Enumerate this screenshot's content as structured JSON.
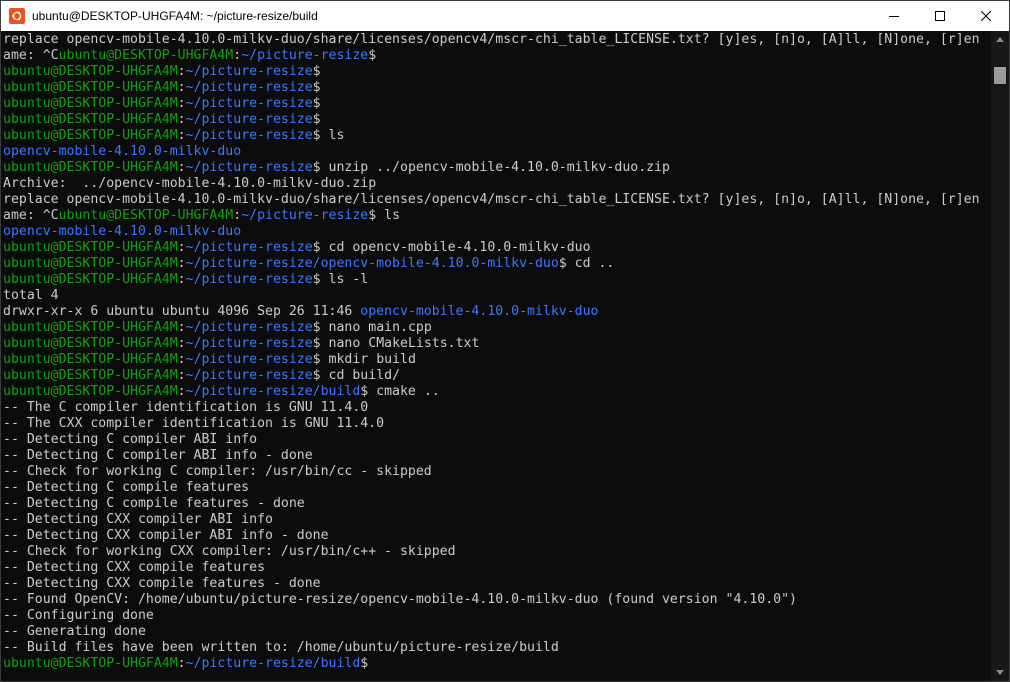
{
  "window": {
    "title": "ubuntu@DESKTOP-UHGFA4M: ~/picture-resize/build",
    "icon": "ubuntu-terminal-icon",
    "controls": [
      "minimize-icon",
      "maximize-icon",
      "close-icon"
    ]
  },
  "colors": {
    "background": "#0c0c0c",
    "text": "#cccccc",
    "prompt_user": "#13a10e",
    "prompt_path": "#3b78ff"
  },
  "terminal": {
    "lines": [
      [
        {
          "t": "replace opencv-mobile-4.10.0-milkv-duo/share/licenses/opencv4/mscr-chi_table_LICENSE.txt? [y]es, [n]o, [A]ll, [N]one, [r]en",
          "c": "white"
        }
      ],
      [
        {
          "t": "ame: ^C",
          "c": "white"
        },
        {
          "t": "ubuntu@DESKTOP-UHGFA4M",
          "c": "green"
        },
        {
          "t": ":",
          "c": "white"
        },
        {
          "t": "~/picture-resize",
          "c": "blue"
        },
        {
          "t": "$",
          "c": "white"
        }
      ],
      [
        {
          "t": "ubuntu@DESKTOP-UHGFA4M",
          "c": "green"
        },
        {
          "t": ":",
          "c": "white"
        },
        {
          "t": "~/picture-resize",
          "c": "blue"
        },
        {
          "t": "$",
          "c": "white"
        }
      ],
      [
        {
          "t": "ubuntu@DESKTOP-UHGFA4M",
          "c": "green"
        },
        {
          "t": ":",
          "c": "white"
        },
        {
          "t": "~/picture-resize",
          "c": "blue"
        },
        {
          "t": "$",
          "c": "white"
        }
      ],
      [
        {
          "t": "ubuntu@DESKTOP-UHGFA4M",
          "c": "green"
        },
        {
          "t": ":",
          "c": "white"
        },
        {
          "t": "~/picture-resize",
          "c": "blue"
        },
        {
          "t": "$",
          "c": "white"
        }
      ],
      [
        {
          "t": "ubuntu@DESKTOP-UHGFA4M",
          "c": "green"
        },
        {
          "t": ":",
          "c": "white"
        },
        {
          "t": "~/picture-resize",
          "c": "blue"
        },
        {
          "t": "$",
          "c": "white"
        }
      ],
      [
        {
          "t": "ubuntu@DESKTOP-UHGFA4M",
          "c": "green"
        },
        {
          "t": ":",
          "c": "white"
        },
        {
          "t": "~/picture-resize",
          "c": "blue"
        },
        {
          "t": "$ ls",
          "c": "white"
        }
      ],
      [
        {
          "t": "opencv-mobile-4.10.0-milkv-duo",
          "c": "blue"
        }
      ],
      [
        {
          "t": "ubuntu@DESKTOP-UHGFA4M",
          "c": "green"
        },
        {
          "t": ":",
          "c": "white"
        },
        {
          "t": "~/picture-resize",
          "c": "blue"
        },
        {
          "t": "$ unzip ../opencv-mobile-4.10.0-milkv-duo.zip",
          "c": "white"
        }
      ],
      [
        {
          "t": "Archive:  ../opencv-mobile-4.10.0-milkv-duo.zip",
          "c": "white"
        }
      ],
      [
        {
          "t": "replace opencv-mobile-4.10.0-milkv-duo/share/licenses/opencv4/mscr-chi_table_LICENSE.txt? [y]es, [n]o, [A]ll, [N]one, [r]en",
          "c": "white"
        }
      ],
      [
        {
          "t": "ame: ^C",
          "c": "white"
        },
        {
          "t": "ubuntu@DESKTOP-UHGFA4M",
          "c": "green"
        },
        {
          "t": ":",
          "c": "white"
        },
        {
          "t": "~/picture-resize",
          "c": "blue"
        },
        {
          "t": "$ ls",
          "c": "white"
        }
      ],
      [
        {
          "t": "opencv-mobile-4.10.0-milkv-duo",
          "c": "blue"
        }
      ],
      [
        {
          "t": "ubuntu@DESKTOP-UHGFA4M",
          "c": "green"
        },
        {
          "t": ":",
          "c": "white"
        },
        {
          "t": "~/picture-resize",
          "c": "blue"
        },
        {
          "t": "$ cd opencv-mobile-4.10.0-milkv-duo",
          "c": "white"
        }
      ],
      [
        {
          "t": "ubuntu@DESKTOP-UHGFA4M",
          "c": "green"
        },
        {
          "t": ":",
          "c": "white"
        },
        {
          "t": "~/picture-resize/opencv-mobile-4.10.0-milkv-duo",
          "c": "blue"
        },
        {
          "t": "$ cd ..",
          "c": "white"
        }
      ],
      [
        {
          "t": "ubuntu@DESKTOP-UHGFA4M",
          "c": "green"
        },
        {
          "t": ":",
          "c": "white"
        },
        {
          "t": "~/picture-resize",
          "c": "blue"
        },
        {
          "t": "$ ls -l",
          "c": "white"
        }
      ],
      [
        {
          "t": "total 4",
          "c": "white"
        }
      ],
      [
        {
          "t": "drwxr-xr-x 6 ubuntu ubuntu 4096 Sep 26 11:46 ",
          "c": "white"
        },
        {
          "t": "opencv-mobile-4.10.0-milkv-duo",
          "c": "blue"
        }
      ],
      [
        {
          "t": "ubuntu@DESKTOP-UHGFA4M",
          "c": "green"
        },
        {
          "t": ":",
          "c": "white"
        },
        {
          "t": "~/picture-resize",
          "c": "blue"
        },
        {
          "t": "$ nano main.cpp",
          "c": "white"
        }
      ],
      [
        {
          "t": "ubuntu@DESKTOP-UHGFA4M",
          "c": "green"
        },
        {
          "t": ":",
          "c": "white"
        },
        {
          "t": "~/picture-resize",
          "c": "blue"
        },
        {
          "t": "$ nano CMakeLists.txt",
          "c": "white"
        }
      ],
      [
        {
          "t": "ubuntu@DESKTOP-UHGFA4M",
          "c": "green"
        },
        {
          "t": ":",
          "c": "white"
        },
        {
          "t": "~/picture-resize",
          "c": "blue"
        },
        {
          "t": "$ mkdir build",
          "c": "white"
        }
      ],
      [
        {
          "t": "ubuntu@DESKTOP-UHGFA4M",
          "c": "green"
        },
        {
          "t": ":",
          "c": "white"
        },
        {
          "t": "~/picture-resize",
          "c": "blue"
        },
        {
          "t": "$ cd build/",
          "c": "white"
        }
      ],
      [
        {
          "t": "ubuntu@DESKTOP-UHGFA4M",
          "c": "green"
        },
        {
          "t": ":",
          "c": "white"
        },
        {
          "t": "~/picture-resize/build",
          "c": "blue"
        },
        {
          "t": "$ cmake ..",
          "c": "white"
        }
      ],
      [
        {
          "t": "-- The C compiler identification is GNU 11.4.0",
          "c": "white"
        }
      ],
      [
        {
          "t": "-- The CXX compiler identification is GNU 11.4.0",
          "c": "white"
        }
      ],
      [
        {
          "t": "-- Detecting C compiler ABI info",
          "c": "white"
        }
      ],
      [
        {
          "t": "-- Detecting C compiler ABI info - done",
          "c": "white"
        }
      ],
      [
        {
          "t": "-- Check for working C compiler: /usr/bin/cc - skipped",
          "c": "white"
        }
      ],
      [
        {
          "t": "-- Detecting C compile features",
          "c": "white"
        }
      ],
      [
        {
          "t": "-- Detecting C compile features - done",
          "c": "white"
        }
      ],
      [
        {
          "t": "-- Detecting CXX compiler ABI info",
          "c": "white"
        }
      ],
      [
        {
          "t": "-- Detecting CXX compiler ABI info - done",
          "c": "white"
        }
      ],
      [
        {
          "t": "-- Check for working CXX compiler: /usr/bin/c++ - skipped",
          "c": "white"
        }
      ],
      [
        {
          "t": "-- Detecting CXX compile features",
          "c": "white"
        }
      ],
      [
        {
          "t": "-- Detecting CXX compile features - done",
          "c": "white"
        }
      ],
      [
        {
          "t": "-- Found OpenCV: /home/ubuntu/picture-resize/opencv-mobile-4.10.0-milkv-duo (found version \"4.10.0\")",
          "c": "white"
        }
      ],
      [
        {
          "t": "-- Configuring done",
          "c": "white"
        }
      ],
      [
        {
          "t": "-- Generating done",
          "c": "white"
        }
      ],
      [
        {
          "t": "-- Build files have been written to: /home/ubuntu/picture-resize/build",
          "c": "white"
        }
      ],
      [
        {
          "t": "ubuntu@DESKTOP-UHGFA4M",
          "c": "green"
        },
        {
          "t": ":",
          "c": "white"
        },
        {
          "t": "~/picture-resize/build",
          "c": "blue"
        },
        {
          "t": "$",
          "c": "white"
        }
      ]
    ]
  }
}
